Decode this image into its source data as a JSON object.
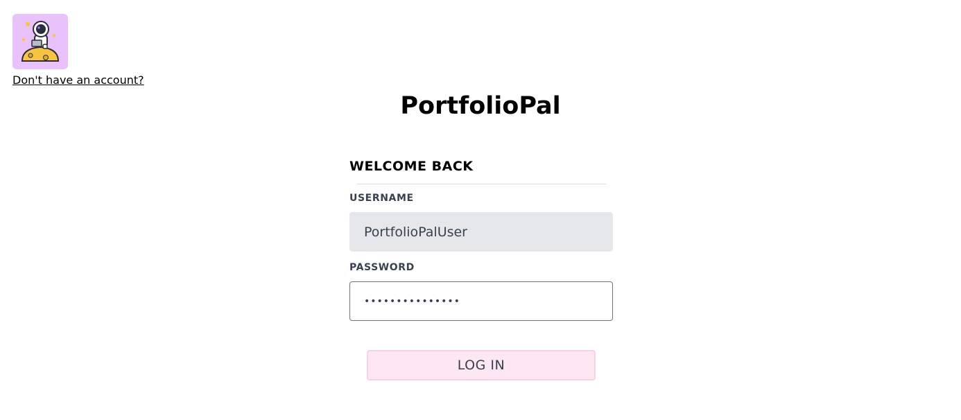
{
  "header": {
    "logo_icon": "astronaut-on-moon-icon",
    "logo_bg_color": "#e9c2fb",
    "signup_link": "Don't have an account?"
  },
  "app": {
    "title": "PortfolioPal"
  },
  "form": {
    "heading": "WELCOME BACK",
    "username": {
      "label": "USERNAME",
      "value": "PortfolioPalUser"
    },
    "password": {
      "label": "PASSWORD",
      "value": "passwordpasswor"
    },
    "submit_label": "LOG IN",
    "submit_bg_color": "#fde7f3",
    "submit_border_color": "#fbcfe8"
  }
}
